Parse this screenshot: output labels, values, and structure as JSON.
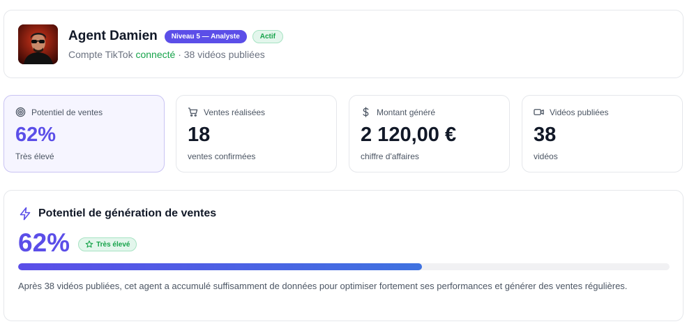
{
  "profile": {
    "name": "Agent Damien",
    "level_badge": "Niveau 5 — Analyste",
    "status_badge": "Actif",
    "account_prefix": "Compte TikTok ",
    "account_status": "connecté",
    "account_suffix": " · 38 vidéos publiées",
    "avatar_icon": "person-with-sunglasses-avatar"
  },
  "stats": [
    {
      "label": "Potentiel de ventes",
      "value": "62%",
      "sub": "Très élevé",
      "icon": "target-icon"
    },
    {
      "label": "Ventes réalisées",
      "value": "18",
      "sub": "ventes confirmées",
      "icon": "cart-icon"
    },
    {
      "label": "Montant généré",
      "value": "2 120,00 €",
      "sub": "chiffre d'affaires",
      "icon": "dollar-icon"
    },
    {
      "label": "Vidéos publiées",
      "value": "38",
      "sub": "vidéos",
      "icon": "video-icon"
    }
  ],
  "potential": {
    "title": "Potentiel de génération de ventes",
    "value": "62%",
    "badge": "Très élevé",
    "progress": 0.62,
    "description": "Après 38 vidéos publiées, cet agent a accumulé suffisamment de données pour optimiser fortement ses performances et générer des ventes régulières."
  },
  "colors": {
    "accent": "#5b4ee8",
    "success": "#16a34a",
    "bar_end": "#3f72e0"
  }
}
